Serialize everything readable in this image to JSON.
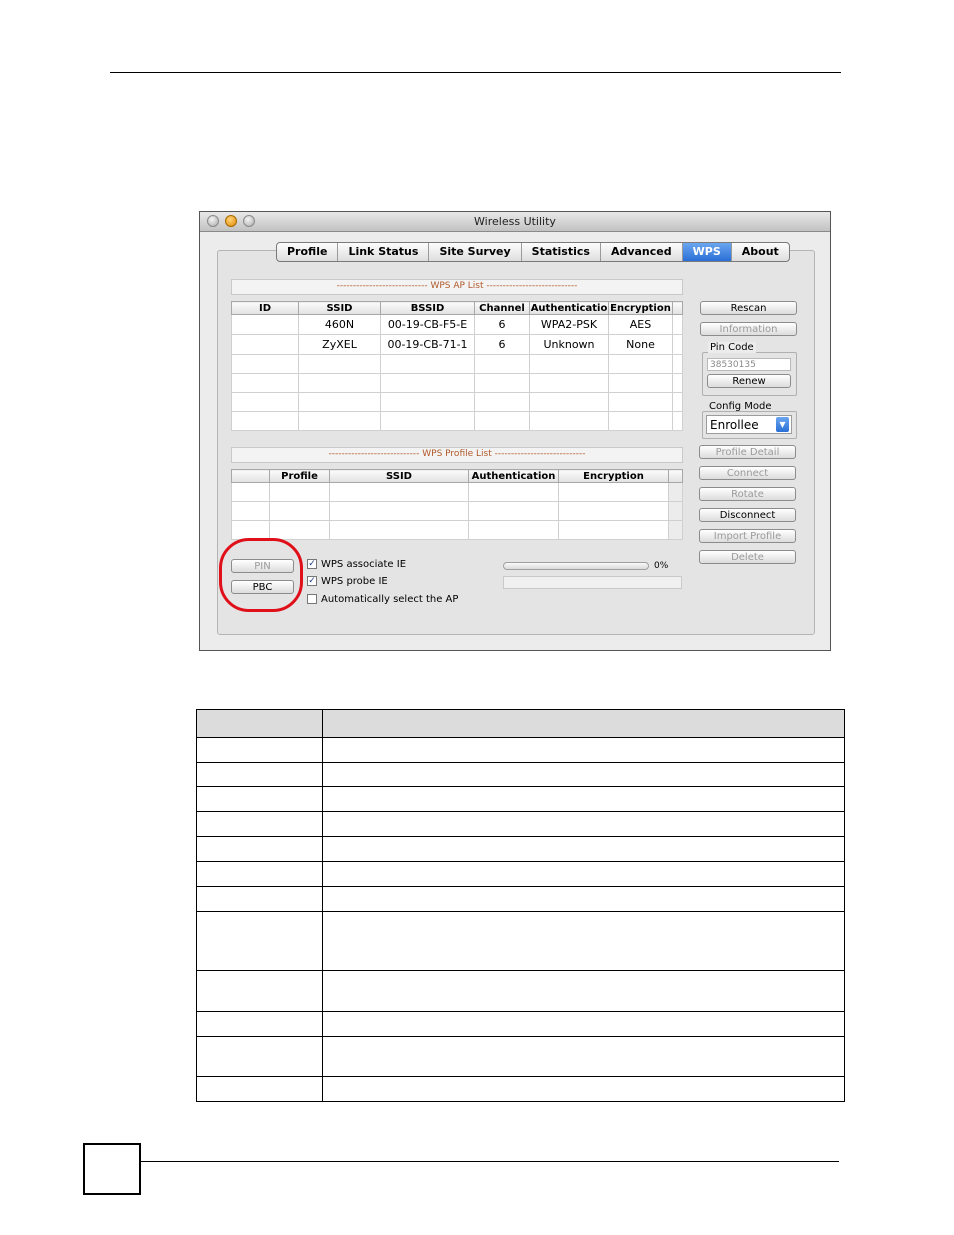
{
  "window": {
    "title": "Wireless Utility",
    "tabs": [
      "Profile",
      "Link Status",
      "Site Survey",
      "Statistics",
      "Advanced",
      "WPS",
      "About"
    ],
    "active_tab": "WPS",
    "ap_list": {
      "section_label": "---------------------------- WPS AP List ----------------------------",
      "columns": [
        "ID",
        "SSID",
        "BSSID",
        "Channel",
        "Authenticatio",
        "Encryption"
      ],
      "rows": [
        [
          "",
          "460N",
          "00-19-CB-F5-E",
          "6",
          "WPA2-PSK",
          "AES"
        ],
        [
          "",
          "ZyXEL",
          "00-19-CB-71-1",
          "6",
          "Unknown",
          "None"
        ]
      ]
    },
    "profile_list": {
      "section_label": "---------------------------- WPS Profile List ----------------------------",
      "columns": [
        "",
        "Profile",
        "SSID",
        "Authentication",
        "Encryption"
      ]
    },
    "buttons": {
      "rescan": "Rescan",
      "information": "Information",
      "renew": "Renew",
      "profile_detail": "Profile Detail",
      "connect": "Connect",
      "rotate": "Rotate",
      "disconnect": "Disconnect",
      "import_profile": "Import Profile",
      "delete": "Delete",
      "pin": "PIN",
      "pbc": "PBC"
    },
    "pin_code": {
      "label": "Pin Code",
      "value": "38530135"
    },
    "config_mode": {
      "label": "Config Mode",
      "value": "Enrollee"
    },
    "options": [
      {
        "label": "WPS associate IE",
        "checked": true
      },
      {
        "label": "WPS probe IE",
        "checked": true
      },
      {
        "label": "Automatically select the AP",
        "checked": false
      }
    ],
    "progress": {
      "text": "0%",
      "value": 0
    },
    "colors": {
      "highlight_circle": "#e0101a",
      "active_tab": "#2a6fd6",
      "section_text": "#b05a2a"
    }
  }
}
